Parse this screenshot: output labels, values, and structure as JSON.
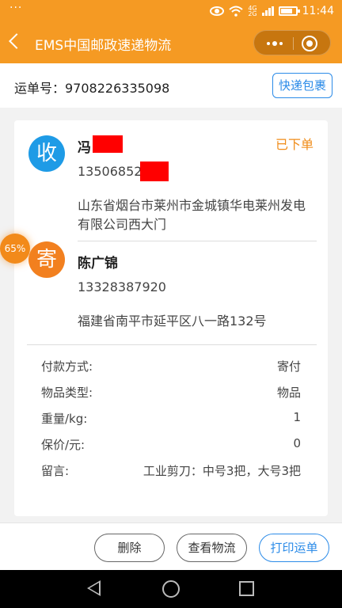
{
  "status_bar": {
    "menu_dots": "···",
    "network_top": "4G",
    "network_bottom": "2G",
    "time": "11:44"
  },
  "title_bar": {
    "title": "EMS中国邮政速递物流"
  },
  "waybill": {
    "text": "运单号：9708226335098",
    "express_button": "快递包裹"
  },
  "recipient": {
    "avatar_char": "收",
    "name": "冯",
    "phone": "13506852",
    "address": "山东省烟台市莱州市金城镇华电莱州发电有限公司西大门",
    "status": "已下单"
  },
  "sender": {
    "avatar_char": "寄",
    "name": "陈广锦",
    "phone": "13328387920",
    "address": "福建省南平市延平区八一路132号"
  },
  "details": [
    {
      "label": "付款方式:",
      "value": "寄付"
    },
    {
      "label": "物品类型:",
      "value": "物品"
    },
    {
      "label": "重量/kg:",
      "value": "1"
    },
    {
      "label": "保价/元:",
      "value": "0"
    },
    {
      "label": "留言:",
      "value": "工业剪刀：中号3把，大号3把"
    }
  ],
  "floating_badge": "65%",
  "actions": {
    "delete": "删除",
    "track": "查看物流",
    "print": "打印运单"
  },
  "colors": {
    "header": "#f59a23",
    "recipient_avatar": "#1e9be6",
    "sender_avatar": "#f2801f",
    "status": "#f08c19",
    "primary_blue": "#2b8be8"
  }
}
